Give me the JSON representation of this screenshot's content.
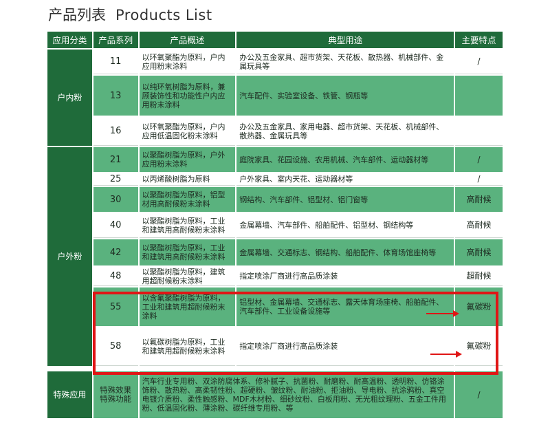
{
  "header": {
    "title_zh": "产品列表",
    "title_en": "Products List"
  },
  "columns": [
    "应用分类",
    "产品系列",
    "产品概述",
    "典型用途",
    "主要特点"
  ],
  "groups": {
    "indoor": "户内粉",
    "outdoor": "户外粉",
    "special": "特殊应用"
  },
  "rows": [
    {
      "series": "11",
      "desc": "以环氧聚酯为原料，户内应用粉末涂料",
      "use": "办公及五金家具、超市货架、天花板、散热器、机械部件、金属玩具等",
      "feature": "/"
    },
    {
      "series": "13",
      "desc": "以纯环氧树脂为原料，兼顾装饰性和功能性户内应用粉末涂料",
      "use": "汽车配件、实验室设备、铁管、钢瓶等",
      "feature": ""
    },
    {
      "series": "16",
      "desc": "以环氧聚酯为原料，户内应用低温固化粉末涂料",
      "use": "办公及五金家具、家用电器、超市货架、天花板、机械部件、散热器、金属玩具等",
      "feature": ""
    },
    {
      "series": "21",
      "desc": "以聚酯树脂为原料，户外应用粉末涂料",
      "use": "庭院家具、花园设施、农用机械、汽车部件、运动器材等",
      "feature": "/"
    },
    {
      "series": "25",
      "desc": "以丙烯酸树脂为原料",
      "use": "户外家具、室内天花、运动器材等",
      "feature": "/"
    },
    {
      "series": "30",
      "desc": "以聚酯树脂为原料，铝型材用高耐候粉末涂料",
      "use": "钢结构、汽车部件、铝型材、铝门窗等",
      "feature": "高耐候"
    },
    {
      "series": "40",
      "desc": "以聚酯树脂为原料，工业和建筑用高耐候粉末涂料",
      "use": "金属幕墙、汽车部件、船舶配件、铝型材、钢结构等",
      "feature": "高耐候"
    },
    {
      "series": "42",
      "desc": "以聚酯树脂为原料，工业和建筑用高耐候粉末涂料",
      "use": "金属幕墙、交通标志、钢结构、船舶配件、体育场馆座椅等",
      "feature": "高耐候"
    },
    {
      "series": "48",
      "desc": "以聚酯树脂为原料，建筑用超耐候粉末涂料",
      "use": "指定喷涂厂商进行高品质涂装",
      "feature": "超耐候"
    },
    {
      "series": "55",
      "desc": "以含氟聚酯树脂为原料，工业和建筑用超耐候粉末涂料",
      "use": "铝型材、金属幕墙、交通标志、露天体育场座椅、船舶配件、汽车部件、工业设备设施等",
      "feature": "氟碳粉"
    },
    {
      "series": "58",
      "desc": "以氟碳树脂为原料，工业和建筑用超耐候粉末涂料",
      "use": "指定喷涂厂商进行高品质涂装",
      "feature": "氟碳粉"
    }
  ],
  "special_row": {
    "series": "特殊效果\n特殊功能",
    "use": "汽车行业专用粉、双涂防腐体系、修补腻子、抗菌粉、耐磨粉、耐高温粉、透明粉、仿铬涂饰粉、散热粉、高柔韧性粉、超硬粉、皱纹粉、耐油粉、拒油粉、导电粉、抗涂鸦粉、真空电镀介质粉、柔性触感粉、MDF木材粉、细砂纹粉、白板用粉、无光粗纹理粉、五金工件用粉、低温固化粉、薄涂粉、碳纤维专用粉、等",
    "feature": "/"
  },
  "colors": {
    "dark_green": "#1f6b3a",
    "light_green": "#5ab27e",
    "highlight_red": "#e01515"
  }
}
